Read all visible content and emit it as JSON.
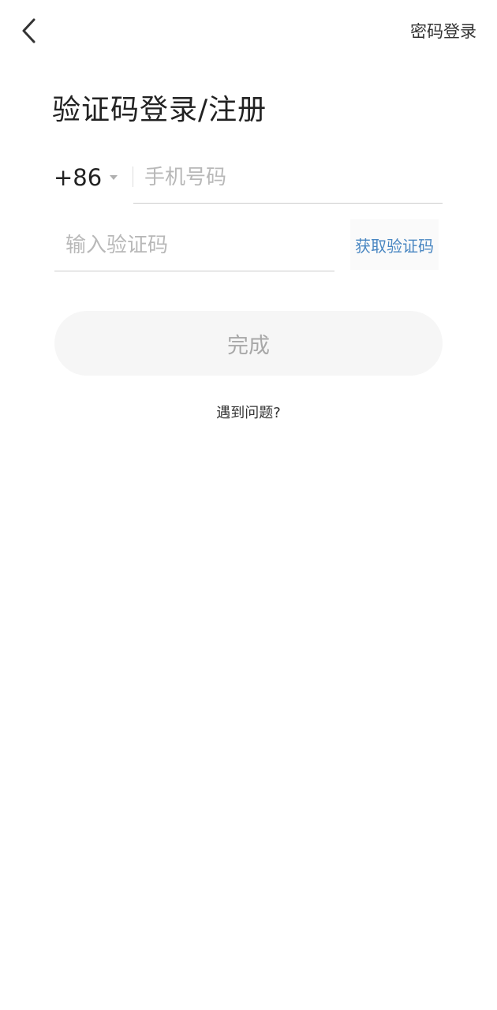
{
  "header": {
    "back_icon": "chevron-left-icon",
    "password_login_label": "密码登录"
  },
  "title": "验证码登录/注册",
  "phone": {
    "country_code": "+86",
    "dropdown_icon": "caret-down-icon",
    "placeholder": "手机号码",
    "value": ""
  },
  "verification": {
    "placeholder": "输入验证码",
    "value": "",
    "get_code_label": "获取验证码"
  },
  "done_button_label": "完成",
  "help_link_label": "遇到问题?",
  "colors": {
    "link_blue": "#4a87c2",
    "disabled_text": "#a8a8a8",
    "button_bg": "#f6f6f6"
  }
}
